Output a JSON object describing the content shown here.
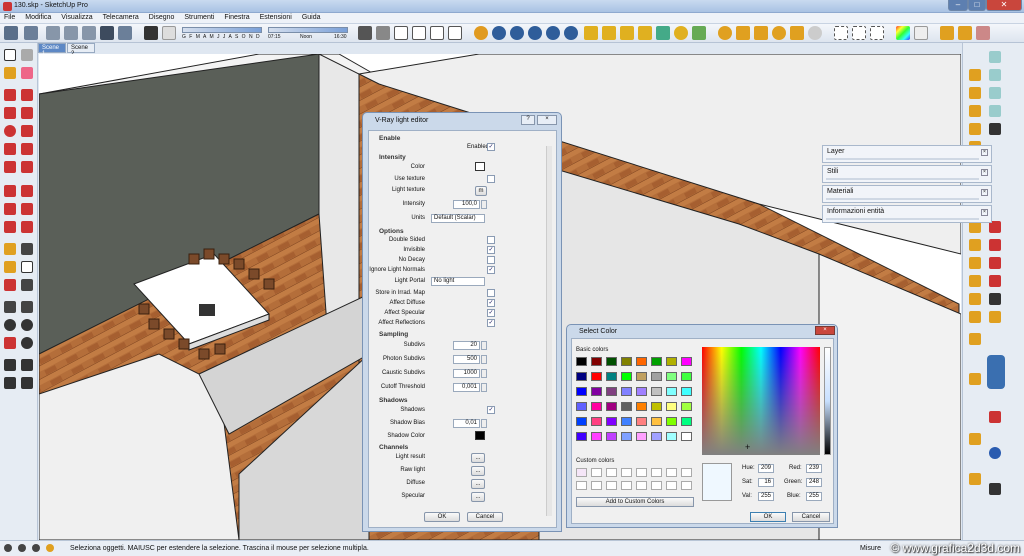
{
  "window": {
    "title": "130.skp - SketchUp Pro"
  },
  "menu": [
    "File",
    "Modifica",
    "Visualizza",
    "Telecamera",
    "Disegno",
    "Strumenti",
    "Finestra",
    "Estensioni",
    "Guida"
  ],
  "shadow_slider": {
    "months": "G F M A M J J A S O N D",
    "time_start": "07:15",
    "time_mid": "Noon",
    "time_end": "16:30"
  },
  "scenes": [
    "Scene 1",
    "Scene 2"
  ],
  "trays": [
    "Layer",
    "Stili",
    "Materiali",
    "Informazioni entità"
  ],
  "vray": {
    "title": "V-Ray light editor",
    "sections": {
      "enable": "Enable",
      "intensity": "Intensity",
      "options": "Options",
      "sampling": "Sampling",
      "shadows": "Shadows",
      "channels": "Channels"
    },
    "labels": {
      "enabled": "Enabled",
      "color": "Color",
      "use_texture": "Use texture",
      "light_texture": "Light texture",
      "intensity": "Intensity",
      "units": "Units",
      "double_sided": "Double Sided",
      "invisible": "Invisible",
      "no_decay": "No Decay",
      "ignore_normals": "Ignore Light Normals",
      "light_portal": "Light Portal",
      "store_irrad": "Store in Irrad. Map",
      "affect_diffuse": "Affect Diffuse",
      "affect_specular": "Affect Specular",
      "affect_reflections": "Affect Reflections",
      "subdivs": "Subdivs",
      "photon_subdivs": "Photon Subdivs",
      "caustic_subdivs": "Caustic Subdivs",
      "cutoff": "Cutoff Threshold",
      "shadows": "Shadows",
      "shadow_bias": "Shadow Bias",
      "shadow_color": "Shadow Color",
      "light_result": "Light result",
      "raw_light": "Raw light",
      "diffuse": "Diffuse",
      "specular": "Specular"
    },
    "values": {
      "light_texture_btn": "m",
      "intensity": "100,0",
      "units": "Default (Scalar)",
      "light_portal": "No light",
      "subdivs": "20",
      "photon_subdivs": "500",
      "caustic_subdivs": "1000",
      "cutoff": "0,001",
      "shadow_bias": "0,01",
      "dots": "..."
    },
    "ok": "OK",
    "cancel": "Cancel"
  },
  "colordlg": {
    "title": "Select Color",
    "basic_label": "Basic colors",
    "custom_label": "Custom colors",
    "add_btn": "Add to Custom Colors",
    "hue_label": "Hue:",
    "sat_label": "Sat:",
    "val_label": "Val:",
    "red_label": "Red:",
    "green_label": "Green:",
    "blue_label": "Blue:",
    "hue": "209",
    "sat": "16",
    "val": "255",
    "red": "239",
    "green": "248",
    "blue": "255",
    "ok": "OK",
    "cancel": "Cancel",
    "basic_colors": [
      "#000000",
      "#800000",
      "#005000",
      "#808000",
      "#ff6600",
      "#00a000",
      "#b0b000",
      "#ff00ff",
      "#000080",
      "#ff0000",
      "#008080",
      "#00ff00",
      "#c0a060",
      "#a0a0a0",
      "#80ff80",
      "#40ff40",
      "#0000ff",
      "#8000a0",
      "#804080",
      "#8080ff",
      "#a080ff",
      "#c0c0c0",
      "#80ffff",
      "#40ffff",
      "#6060ff",
      "#ff00a0",
      "#a00080",
      "#606060",
      "#ff8000",
      "#c0c000",
      "#ffff80",
      "#a0ff40",
      "#0040ff",
      "#ff4080",
      "#8000ff",
      "#4080ff",
      "#ff8080",
      "#ffc040",
      "#80ff00",
      "#00ff80",
      "#4000ff",
      "#ff40ff",
      "#c040ff",
      "#80a0ff",
      "#ffa0ff",
      "#a0a0ff",
      "#a0ffff",
      "#ffffff"
    ]
  },
  "status": {
    "text": "Seleziona oggetti. MAIUSC per estendere la selezione. Trascina il mouse per selezione multipla.",
    "measure": "Misure"
  },
  "watermark": "© www.grafica2d3d.com"
}
